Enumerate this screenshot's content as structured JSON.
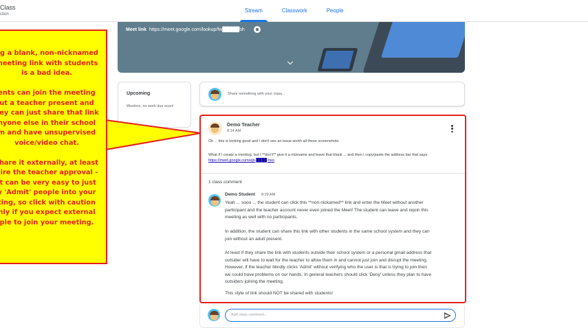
{
  "header": {
    "title": "Class",
    "subtitle": "ction",
    "tabs": [
      {
        "label": "Stream",
        "active": true
      },
      {
        "label": "Classwork",
        "active": false
      },
      {
        "label": "People",
        "active": false
      }
    ]
  },
  "banner": {
    "meet_label": "Meet link",
    "meet_url": "https://meet.google.com/lookup/fw█████bh"
  },
  "upcoming": {
    "title": "Upcoming",
    "text": "Woohoo, no work due soon!"
  },
  "share": {
    "placeholder": "Share something with your class..."
  },
  "post": {
    "author": "Demo Teacher",
    "time": "8:14 AM",
    "body1": "Ok ... this is looking good and I don't see an issue worth all these screenshots.",
    "body2": "What if I create a meeting, but I **don't** give it a nickname and leave that blank ... and then I copy/paste the address bar that says: ",
    "link": "https://meet.google.com/ejb-████-heo",
    "comment_count": "1 class comment",
    "comment": {
      "author": "Demo Student",
      "time": "8:29 AM",
      "lines": [
        "Yeah ... sooo ... the student can click this **non-nickamed** link and enter the Meet without another",
        "participant and the teacher account never even joined the Meet! The student can leave and rejoin this",
        "meeting as well with no participants.",
        "In addition, the student can share this link with other students in the same school system and they can",
        "join without an adult present.",
        "At least if they share the link with students outside their school system or a personal gmail address that",
        "outsider will have to wait for the teacher to allow them in and cannot just join and disrupt the meeting.",
        "However, if the teacher blindly clicks 'Admit' without verifying who the user is that is trying to join then",
        "we could have problems on our hands. In general teachers should click 'Deny' unless they plan to have",
        "outsiders joining the meeting.",
        "This style of link should NOT be shared with students!"
      ]
    }
  },
  "add_comment": {
    "placeholder": "Add class comment..."
  },
  "callout": {
    "paragraphs": [
      [
        "ng a blank, non-nicknamed",
        "meeting link with students",
        "is a bad idea."
      ],
      [
        "ents can join the meeting",
        "ut a teacher present and",
        "hey can just share that link",
        "nyone else in their school",
        "m and have unsupervised",
        "voice/video chat."
      ],
      [
        "share it externally, at least",
        "uire the teacher approval -",
        "it can be very easy to just",
        "y 'Admit' people into your",
        "ting, so click with caution",
        "nly if you expect external",
        "ple to join your meeting."
      ]
    ]
  },
  "colors": {
    "accent": "#1a73e8",
    "callout_bg": "#ffff00",
    "callout_border": "#e6201a"
  }
}
